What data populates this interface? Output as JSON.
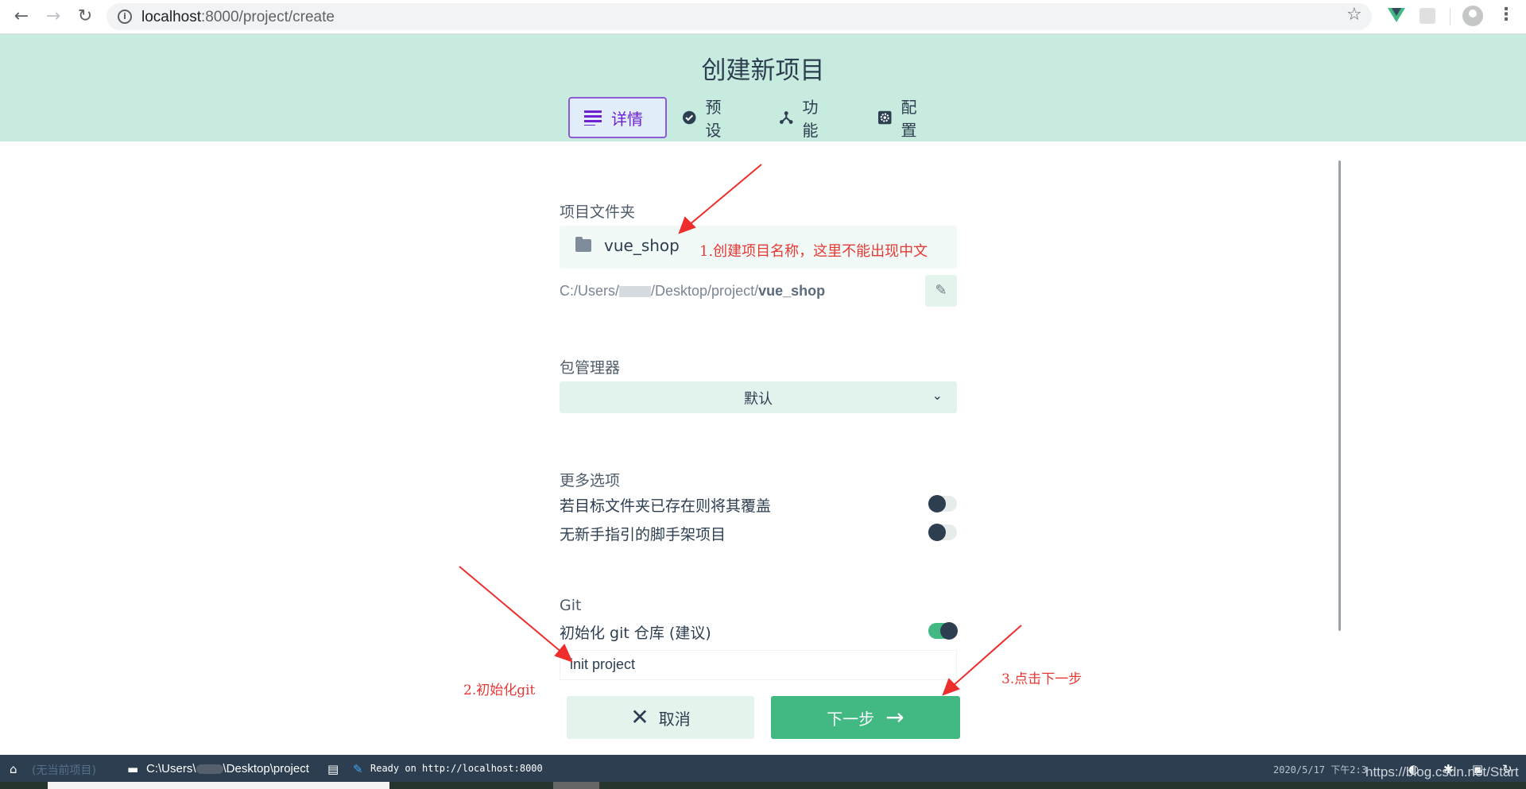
{
  "browser": {
    "url_host": "localhost",
    "url_path": ":8000/project/create"
  },
  "header": {
    "title": "创建新项目",
    "tabs": [
      {
        "label": "详情",
        "icon": "details-icon",
        "active": true
      },
      {
        "label": "预设",
        "icon": "check-circle-icon",
        "active": false
      },
      {
        "label": "功能",
        "icon": "fork-icon",
        "active": false
      },
      {
        "label": "配置",
        "icon": "gear-icon",
        "active": false
      }
    ]
  },
  "form": {
    "folder_label": "项目文件夹",
    "folder_name": "vue_shop",
    "path_prefix": "C:/Users/",
    "path_middle": "/Desktop/project/",
    "path_last": "vue_shop",
    "package_manager_label": "包管理器",
    "package_manager_value": "默认",
    "more_options_label": "更多选项",
    "option_overwrite": "若目标文件夹已存在则将其覆盖",
    "option_overwrite_enabled": false,
    "option_no_guide": "无新手指引的脚手架项目",
    "option_no_guide_enabled": false,
    "git_label": "Git",
    "git_init_label": "初始化 git 仓库 (建议)",
    "git_init_enabled": true,
    "commit_message": "init project",
    "cancel_label": "取消",
    "next_label": "下一步"
  },
  "annotations": {
    "a1": "1.创建项目名称，这里不能出现中文",
    "a2": "2.初始化git",
    "a3": "3.点击下一步",
    "color": "#e53935"
  },
  "statusbar": {
    "no_project": "(无当前项目)",
    "cwd_prefix": "C:\\Users\\",
    "cwd_suffix": "\\Desktop\\project",
    "log": "Ready on http://localhost:8000",
    "datetime": "2020/5/17 下午2:3",
    "watermark": "https://blog.csdn.net/Start"
  },
  "colors": {
    "header_bg": "#c8ebdf",
    "accent_green": "#42b983",
    "active_tab": "#6d1fd1",
    "statusbar_bg": "#2c3e50"
  }
}
